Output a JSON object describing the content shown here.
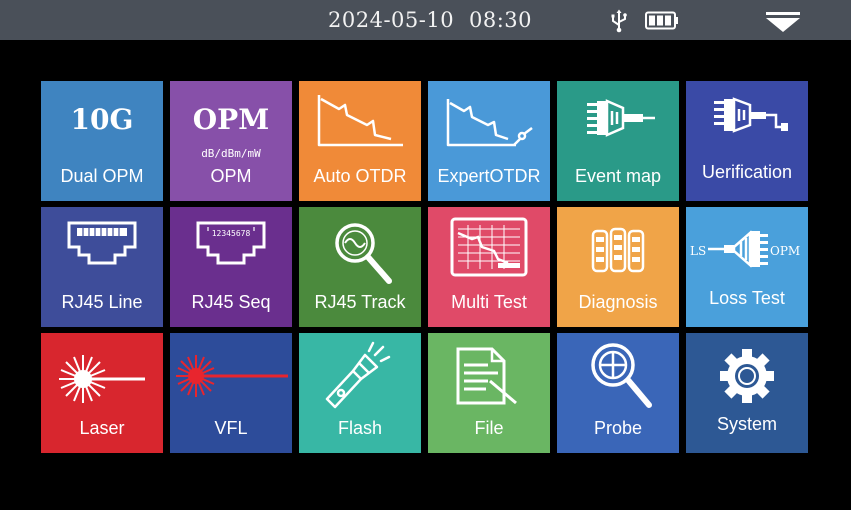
{
  "status": {
    "date": "2024-05-10",
    "time": "08:30",
    "icons": [
      "usb-icon",
      "battery-icon",
      "dropdown-arrow-icon"
    ]
  },
  "tiles": [
    {
      "label": "Dual OPM",
      "big": "10G",
      "color": "#3f84c0",
      "icon": "10g-text-icon"
    },
    {
      "label": "OPM",
      "big": "OPM",
      "sub": "dB/dBm/mW",
      "color": "#8750a9",
      "icon": "opm-text-icon"
    },
    {
      "label": "Auto OTDR",
      "color": "#f08a38",
      "icon": "otdr-trace-icon"
    },
    {
      "label": "ExpertOTDR",
      "color": "#4a99d8",
      "icon": "expert-otdr-trace-icon"
    },
    {
      "label": "Event map",
      "color": "#2a9a88",
      "icon": "event-map-connector-icon"
    },
    {
      "label": "Uerification",
      "color": "#3a4aa6",
      "icon": "verification-connector-icon"
    },
    {
      "label": "RJ45  Line",
      "color": "#3e4d9a",
      "icon": "rj45-port-icon"
    },
    {
      "label": "RJ45  Seq",
      "pins": "12345678",
      "color": "#6a2f8e",
      "icon": "rj45-sequence-port-icon"
    },
    {
      "label": "RJ45 Track",
      "color": "#4b8a3d",
      "icon": "magnifier-wave-icon"
    },
    {
      "label": "Multi Test",
      "color": "#e04a68",
      "icon": "multi-test-chart-icon"
    },
    {
      "label": "Diagnosis",
      "color": "#f0a448",
      "icon": "diagnosis-modules-icon"
    },
    {
      "label": "Loss Test",
      "left": "LS",
      "right": "OPM",
      "color": "#4aa0db",
      "icon": "loss-test-connector-icon"
    },
    {
      "label": "Laser",
      "color": "#d8262e",
      "icon": "laser-burst-icon"
    },
    {
      "label": "VFL",
      "color": "#2d4c9a",
      "icon": "vfl-red-laser-icon"
    },
    {
      "label": "Flash",
      "color": "#38b7a5",
      "icon": "flashlight-icon"
    },
    {
      "label": "File",
      "color": "#6ab663",
      "icon": "file-document-icon"
    },
    {
      "label": "Probe",
      "color": "#3a66b8",
      "icon": "probe-magnifier-icon"
    },
    {
      "label": "System",
      "color": "#2d5894",
      "icon": "gear-icon"
    }
  ]
}
